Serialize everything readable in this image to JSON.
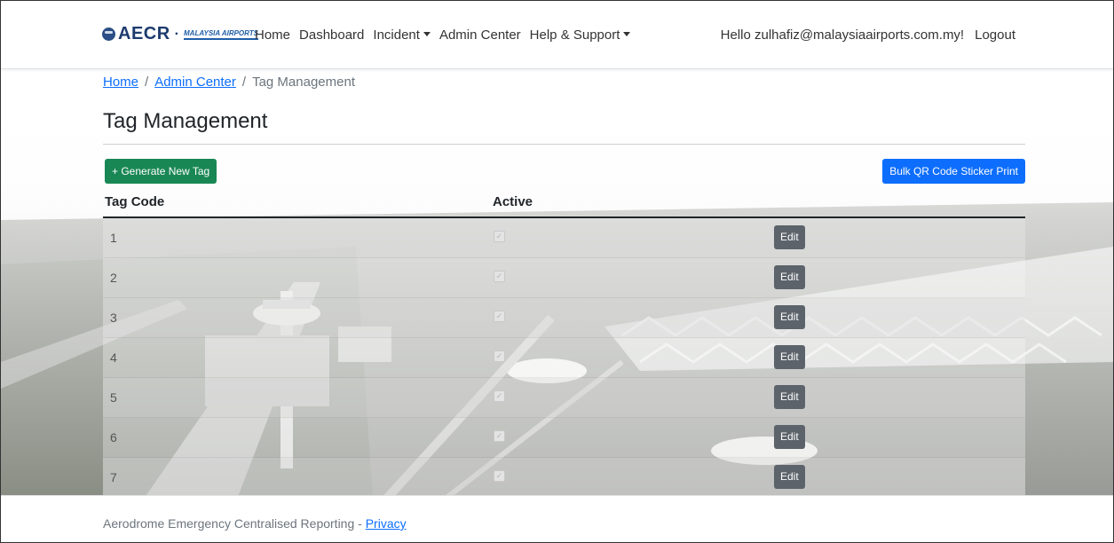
{
  "brand": {
    "name": "AECR",
    "partner_logo": "MALAYSIA AIRPORTS"
  },
  "nav": {
    "home": "Home",
    "dashboard": "Dashboard",
    "incident": "Incident",
    "admin_center": "Admin Center",
    "help_support": "Help & Support"
  },
  "user": {
    "greeting": "Hello zulhafiz@malaysiaairports.com.my!",
    "logout": "Logout"
  },
  "breadcrumb": {
    "home": "Home",
    "admin_center": "Admin Center",
    "current": "Tag Management",
    "separator": "/"
  },
  "page": {
    "title": "Tag Management"
  },
  "actions": {
    "generate": "+ Generate New Tag",
    "bulk_print": "Bulk QR Code Sticker Print"
  },
  "table": {
    "headers": {
      "tag_code": "Tag Code",
      "active": "Active"
    },
    "rows": [
      {
        "code": "1",
        "active": true,
        "edit": "Edit"
      },
      {
        "code": "2",
        "active": true,
        "edit": "Edit"
      },
      {
        "code": "3",
        "active": true,
        "edit": "Edit"
      },
      {
        "code": "4",
        "active": true,
        "edit": "Edit"
      },
      {
        "code": "5",
        "active": true,
        "edit": "Edit"
      },
      {
        "code": "6",
        "active": true,
        "edit": "Edit"
      },
      {
        "code": "7",
        "active": true,
        "edit": "Edit"
      }
    ]
  },
  "footer": {
    "text": "Aerodrome Emergency Centralised Reporting - ",
    "privacy": "Privacy"
  },
  "colors": {
    "primary": "#0d6efd",
    "success": "#198754",
    "secondary": "#5c636a"
  }
}
